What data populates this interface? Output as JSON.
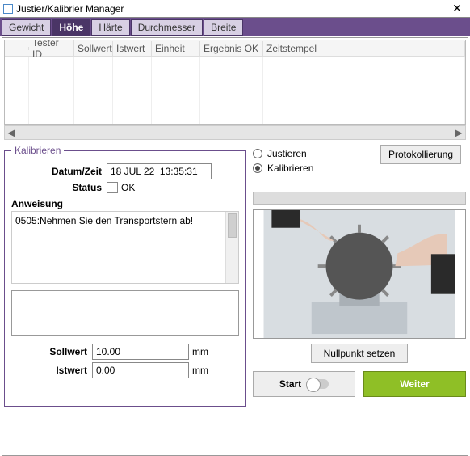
{
  "window": {
    "title": "Justier/Kalibrier Manager"
  },
  "tabs": [
    {
      "label": "Gewicht"
    },
    {
      "label": "Höhe"
    },
    {
      "label": "Härte"
    },
    {
      "label": "Durchmesser"
    },
    {
      "label": "Breite"
    }
  ],
  "tabs_active_index": 1,
  "grid": {
    "columns": [
      "",
      "Tester ID",
      "Sollwert",
      "Istwert",
      "Einheit",
      "Ergebnis OK",
      "Zeitstempel"
    ]
  },
  "kalibrieren": {
    "legend": "Kalibrieren",
    "datum_label": "Datum/Zeit",
    "datum_value": "18 JUL 22  13:35:31",
    "status_label": "Status",
    "status_ok": "OK",
    "anweisung_label": "Anweisung",
    "anweisung_text": "0505:Nehmen Sie den Transportstern ab!",
    "sollwert_label": "Sollwert",
    "sollwert_value": "10.00",
    "istwert_label": "Istwert",
    "istwert_value": "0.00",
    "unit": "mm"
  },
  "right": {
    "justieren_label": "Justieren",
    "kalibrieren_label": "Kalibrieren",
    "protokollierung": "Protokollierung",
    "nullpunkt": "Nullpunkt setzen",
    "start": "Start",
    "weiter": "Weiter"
  }
}
